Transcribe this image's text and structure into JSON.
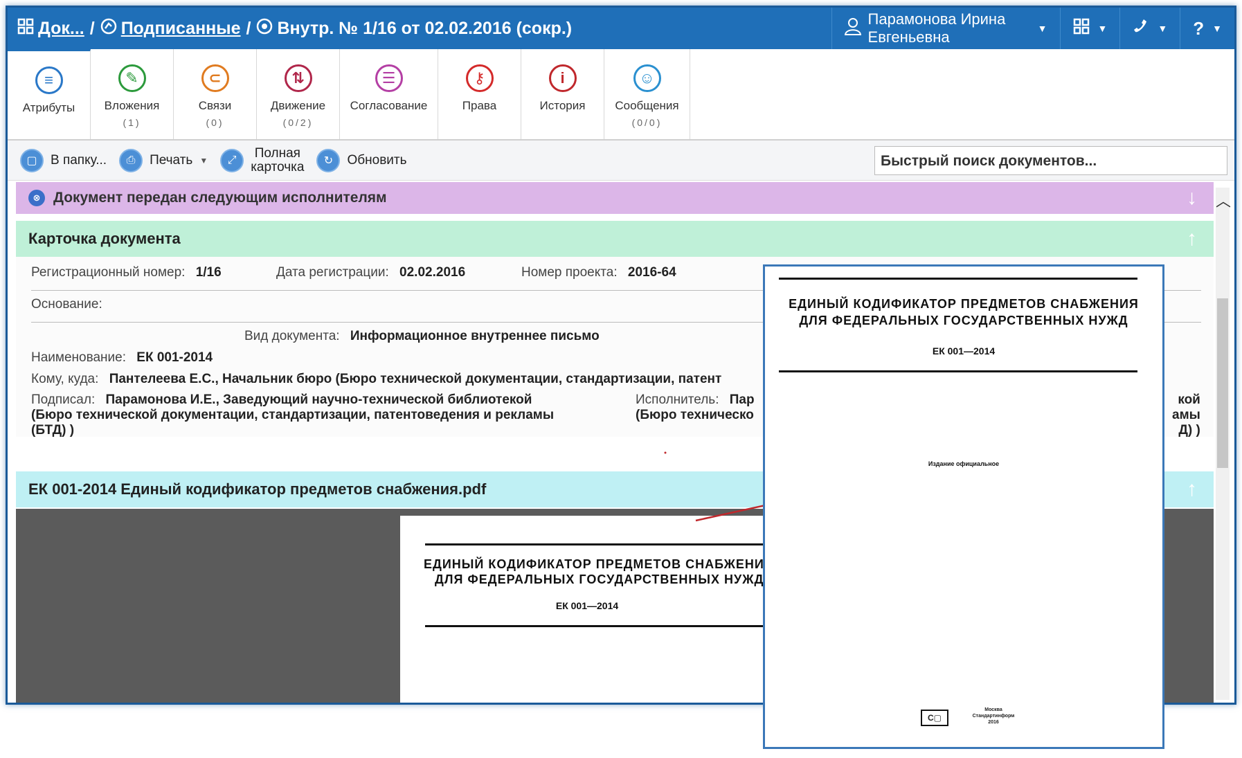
{
  "breadcrumb": {
    "root": "Док...",
    "sep": "/",
    "folder": "Подписанные",
    "current": "Внутр. № 1/16 от 02.02.2016 (сокр.)"
  },
  "user": {
    "name": "Парамонова Ирина Евгеньевна"
  },
  "tabs": [
    {
      "label": "Атрибуты",
      "count": "",
      "icon": "list-icon",
      "color": "#2a78c8"
    },
    {
      "label": "Вложения",
      "count": "(1)",
      "icon": "attachment-icon",
      "color": "#2c9a3c"
    },
    {
      "label": "Связи",
      "count": "(0)",
      "icon": "links-icon",
      "color": "#e07b20"
    },
    {
      "label": "Движение",
      "count": "(0/2)",
      "icon": "movement-icon",
      "color": "#b0264a"
    },
    {
      "label": "Согласование",
      "count": "",
      "icon": "approval-icon",
      "color": "#b43fa4"
    },
    {
      "label": "Права",
      "count": "",
      "icon": "rights-icon",
      "color": "#d42a2a"
    },
    {
      "label": "История",
      "count": "",
      "icon": "history-icon",
      "color": "#c0282c"
    },
    {
      "label": "Сообщения",
      "count": "(0/0)",
      "icon": "messages-icon",
      "color": "#2a90d0"
    }
  ],
  "toolbar": {
    "to_folder": "В папку...",
    "print": "Печать",
    "full_card_1": "Полная",
    "full_card_2": "карточка",
    "refresh": "Обновить",
    "search_placeholder": "Быстрый поиск документов..."
  },
  "sections": {
    "transferred": "Документ передан следующим исполнителям",
    "card": "Карточка документа",
    "attachment": "ЕК 001-2014 Единый кодификатор предметов снабжения.pdf"
  },
  "card": {
    "reg_no_label": "Регистрационный номер:",
    "reg_no": "1/16",
    "reg_date_label": "Дата регистрации:",
    "reg_date": "02.02.2016",
    "project_no_label": "Номер проекта:",
    "project_no": "2016-64",
    "basis_label": "Основание:",
    "doc_type_label": "Вид документа:",
    "doc_type": "Информационное внутреннее письмо",
    "name_label": "Наименование:",
    "name": "ЕК 001-2014",
    "to_label": "Кому, куда:",
    "to": "Пантелеева Е.С., Начальник бюро (Бюро технической документации, стандартизации, патент",
    "signed_label": "Подписал:",
    "signed_1": "Парамонова И.Е., Заведующий научно-технической библиотекой",
    "signed_2": "(Бюро технической документации, стандартизации, патентоведения и рекламы",
    "signed_3": "(БТД) )",
    "executor_label": "Исполнитель:",
    "executor_1": "Пар",
    "executor_2": "(Бюро техническо",
    "executor_tail_1": "кой",
    "executor_tail_2": "амы",
    "executor_tail_3": "Д) )"
  },
  "document": {
    "title_1": "ЕДИНЫЙ КОДИФИКАТОР ПРЕДМЕТОВ СНАБЖЕНИЯ",
    "title_2": "ДЛЯ ФЕДЕРАЛЬНЫХ ГОСУДАРСТВЕННЫХ НУЖД",
    "thumb_title_1": "ЕДИНЫЙ КОДИФИКАТОР ПРЕДМЕТОВ СНАБЖЕНИ",
    "thumb_title_2": "ДЛЯ ФЕДЕРАЛЬНЫХ ГОСУДАРСТВЕННЫХ НУЖД",
    "code": "ЕК 001—2014",
    "official": "Издание официальное",
    "publisher_1": "Москва",
    "publisher_2": "Стандартинформ",
    "publisher_3": "2016"
  }
}
